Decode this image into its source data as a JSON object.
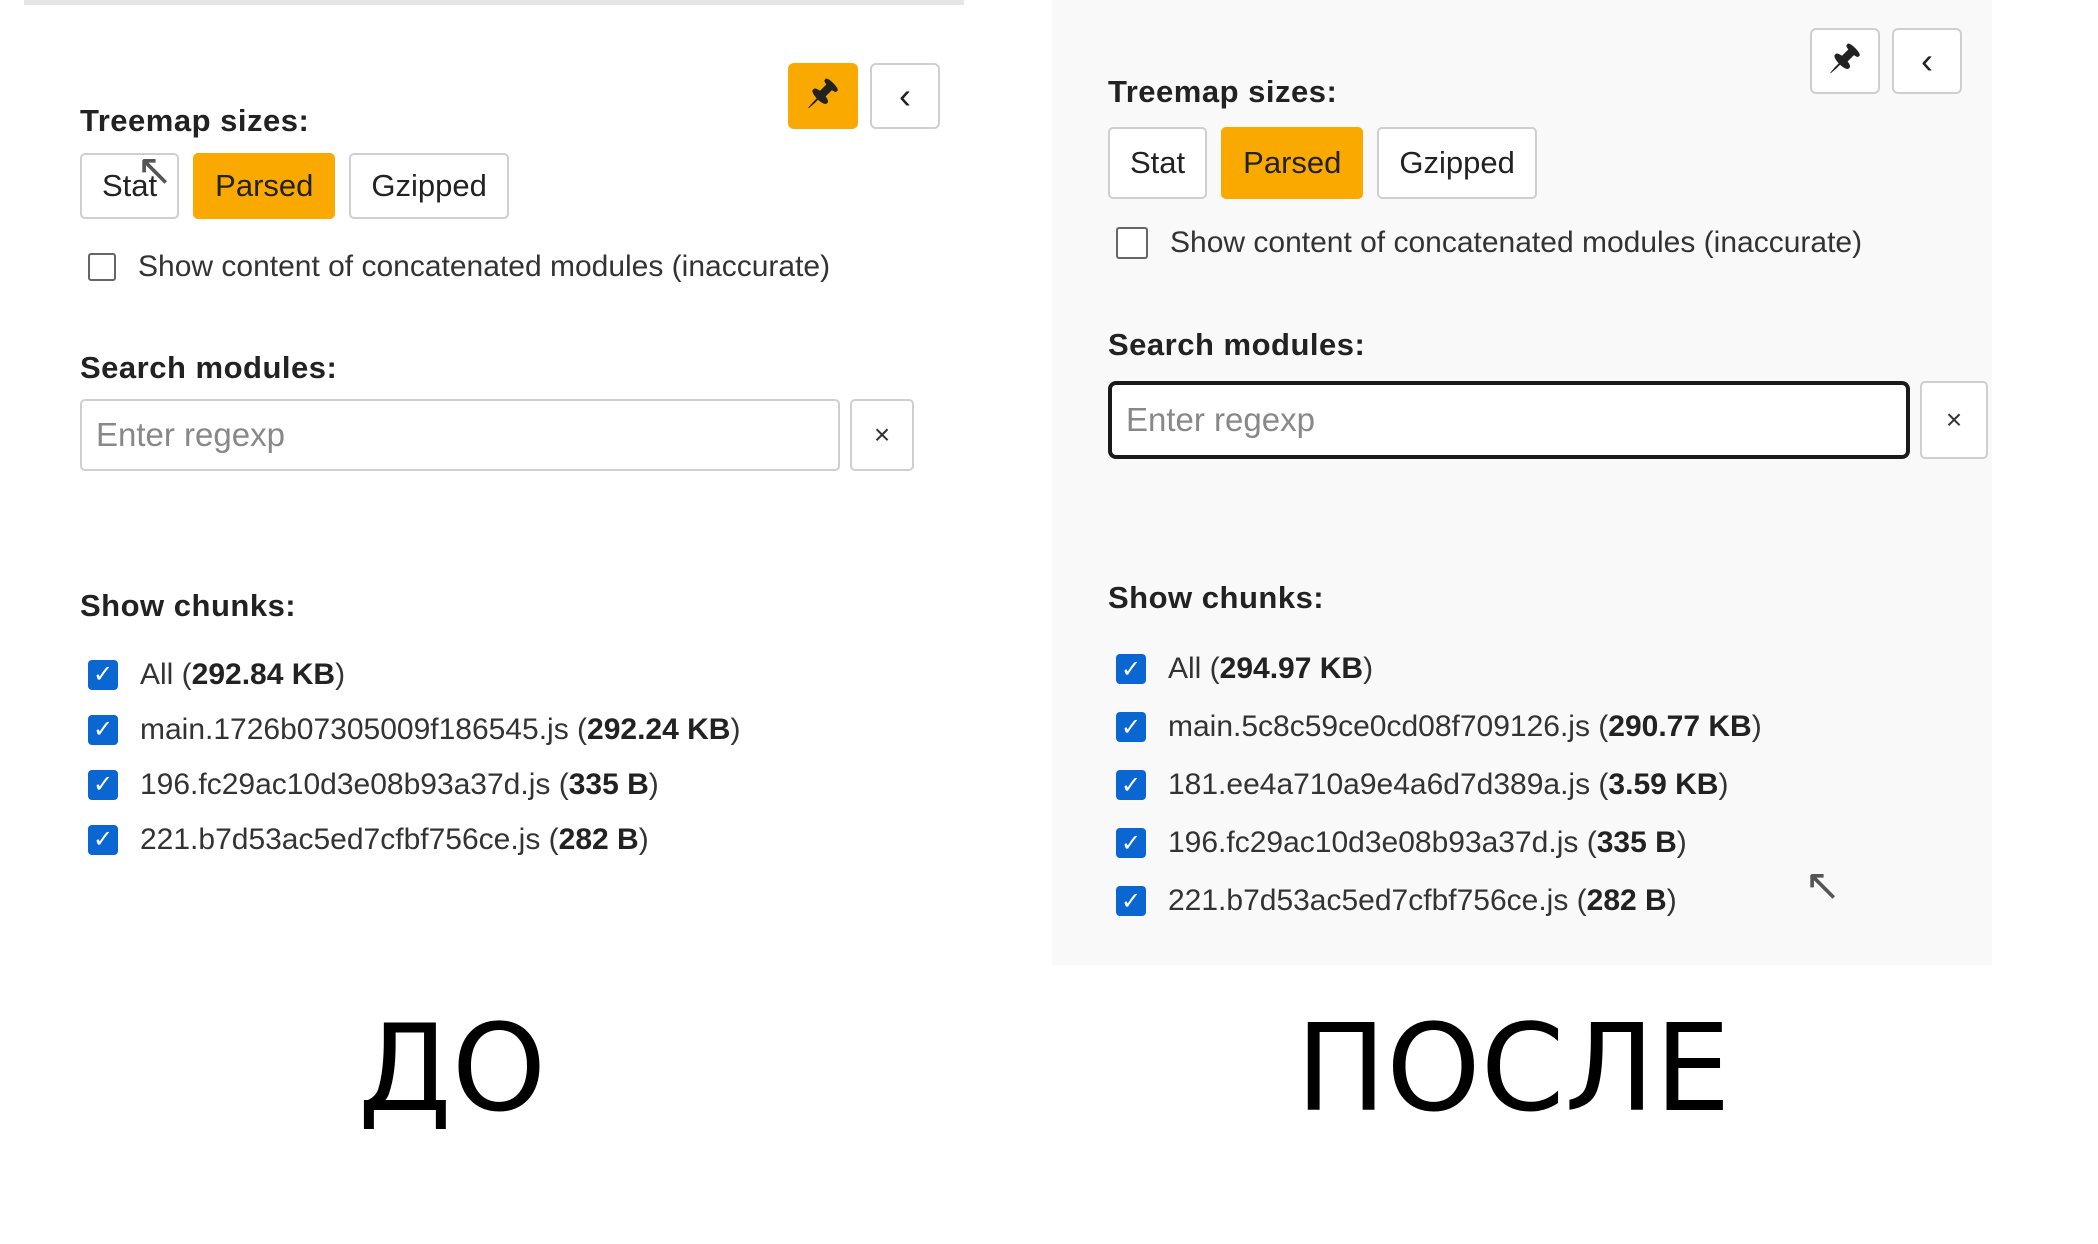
{
  "before": {
    "treemap_label": "Treemap sizes:",
    "size_buttons": [
      "Stat",
      "Parsed",
      "Gzipped"
    ],
    "active_size": "Parsed",
    "concat_label": "Show content of concatenated modules (inaccurate)",
    "search_label": "Search modules:",
    "search_placeholder": "Enter regexp",
    "clear_label": "×",
    "chunks_label": "Show chunks:",
    "chunks": [
      {
        "name": "All",
        "size": "292.84 KB"
      },
      {
        "name": "main.1726b07305009f186545.js",
        "size": "292.24 KB"
      },
      {
        "name": "196.fc29ac10d3e08b93a37d.js",
        "size": "335 B"
      },
      {
        "name": "221.b7d53ac5ed7cfbf756ce.js",
        "size": "282 B"
      }
    ],
    "caption": "ДО"
  },
  "after": {
    "treemap_label": "Treemap sizes:",
    "size_buttons": [
      "Stat",
      "Parsed",
      "Gzipped"
    ],
    "active_size": "Parsed",
    "concat_label": "Show content of concatenated modules (inaccurate)",
    "search_label": "Search modules:",
    "search_placeholder": "Enter regexp",
    "clear_label": "×",
    "chunks_label": "Show chunks:",
    "chunks": [
      {
        "name": "All",
        "size": "294.97 KB"
      },
      {
        "name": "main.5c8c59ce0cd08f709126.js",
        "size": "290.77 KB"
      },
      {
        "name": "181.ee4a710a9e4a6d7d389a.js",
        "size": "3.59 KB"
      },
      {
        "name": "196.fc29ac10d3e08b93a37d.js",
        "size": "335 B"
      },
      {
        "name": "221.b7d53ac5ed7cfbf756ce.js",
        "size": "282 B"
      }
    ],
    "caption": "ПОСЛЕ"
  },
  "icons": {
    "pin": "pin-icon",
    "collapse": "chevron-left-icon",
    "check": "check-icon"
  },
  "colors": {
    "accent": "#f9a900",
    "checkbox": "#0a66d1"
  }
}
